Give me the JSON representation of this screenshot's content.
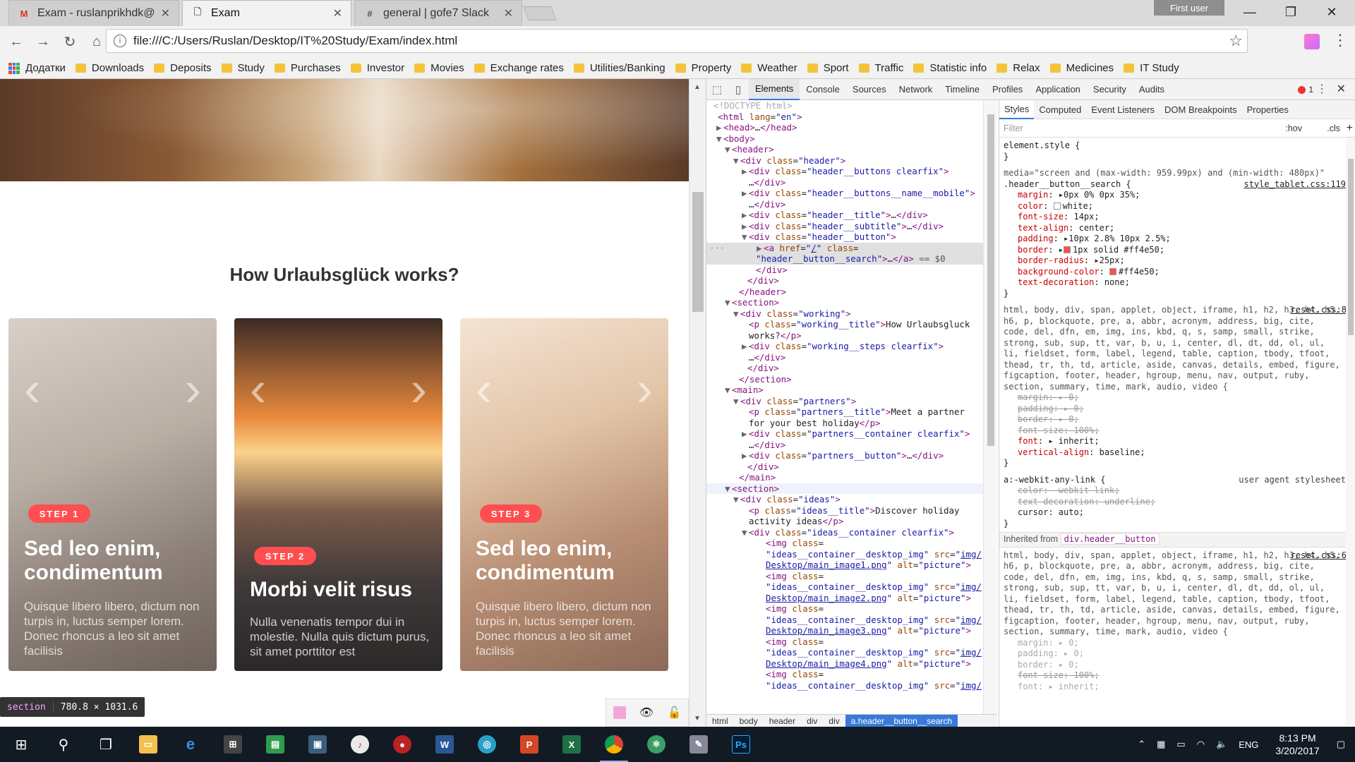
{
  "tabs": [
    {
      "title": "Exam - ruslanprikhdk@g",
      "icon": "gmail-icon"
    },
    {
      "title": "Exam",
      "icon": "page-icon"
    },
    {
      "title": "general | gofe7 Slack",
      "icon": "slack-icon"
    }
  ],
  "profile_label": "First user",
  "url": "file:///C:/Users/Ruslan/Desktop/IT%20Study/Exam/index.html",
  "bookmarks": [
    "Додатки",
    "Downloads",
    "Deposits",
    "Study",
    "Purchases",
    "Investor",
    "Movies",
    "Exchange rates",
    "Utilities/Banking",
    "Property",
    "Weather",
    "Sport",
    "Traffic",
    "Statistic info",
    "Relax",
    "Medicines",
    "IT Study"
  ],
  "page": {
    "works_title": "How Urlaubsglück works?",
    "cards": [
      {
        "step": "STEP 1",
        "heading": "Sed leo enim, condimentum",
        "text": "Quisque libero libero, dictum non turpis in, luctus semper lorem. Donec rhoncus a leo sit amet facilisis"
      },
      {
        "step": "STEP 2",
        "heading": "Morbi velit risus",
        "text": "Nulla venenatis tempor dui in molestie. Nulla quis dictum purus, sit amet porttitor est"
      },
      {
        "step": "STEP 3",
        "heading": "Sed leo enim, condimentum",
        "text": "Quisque libero libero, dictum non turpis in, luctus semper lorem. Donec rhoncus a leo sit amet facilisis"
      }
    ],
    "section_tag": "section",
    "section_size": "780.8 × 1031.6"
  },
  "devtools": {
    "tabs": [
      "Elements",
      "Console",
      "Sources",
      "Network",
      "Timeline",
      "Profiles",
      "Application",
      "Security",
      "Audits"
    ],
    "error_count": "1",
    "breadcrumbs": [
      "html",
      "body",
      "header",
      "div",
      "div",
      "a.header__button__search"
    ],
    "style_tabs": [
      "Styles",
      "Computed",
      "Event Listeners",
      "DOM Breakpoints",
      "Properties"
    ],
    "filter_placeholder": "Filter",
    "hov": ":hov",
    "cls": ".cls",
    "inherited_label": "Inherited from",
    "inherited_from": "div.header__button",
    "sources": {
      "tablet": "style_tablet.css:119",
      "reset1": "reset.css:8",
      "reset2": "reset.css:6",
      "ua": "user agent stylesheet"
    },
    "media": "media=\"screen and (max-width: 959.99px) and (min-width: 480px)\"",
    "selector": ".header__button__search {",
    "props": [
      {
        "n": "margin",
        "v": "0px 0% 0px 35%;"
      },
      {
        "n": "color",
        "v": "white;"
      },
      {
        "n": "font-size",
        "v": "14px;"
      },
      {
        "n": "text-align",
        "v": "center;"
      },
      {
        "n": "padding",
        "v": "10px 2.8% 10px 2.5%;"
      },
      {
        "n": "border",
        "v": "1px solid #ff4e50;"
      },
      {
        "n": "border-radius",
        "v": "25px;"
      },
      {
        "n": "background-color",
        "v": "#ff4e50;"
      },
      {
        "n": "text-decoration",
        "v": "none;"
      }
    ],
    "reset_selector": "html, body, div, span, applet, object, iframe, h1, h2, h3, h4, h5, h6, p, blockquote, pre, a, abbr, acronym, address, big, cite, code, del, dfn, em, img, ins, kbd, q, s, samp, small, strike, strong, sub, sup, tt, var, b, u, i, center, dl, dt, dd, ol, ul, li, fieldset, form, label, legend, table, caption, tbody, tfoot, thead, tr, th, td, article, aside, canvas, details, embed, figure, figcaption, footer, header, hgroup, menu, nav, output, ruby, section, summary, time, mark, audio, video {",
    "accent": "#ff4e50"
  },
  "taskbar": {
    "lang": "ENG",
    "time": "8:13 PM",
    "date": "3/20/2017"
  }
}
